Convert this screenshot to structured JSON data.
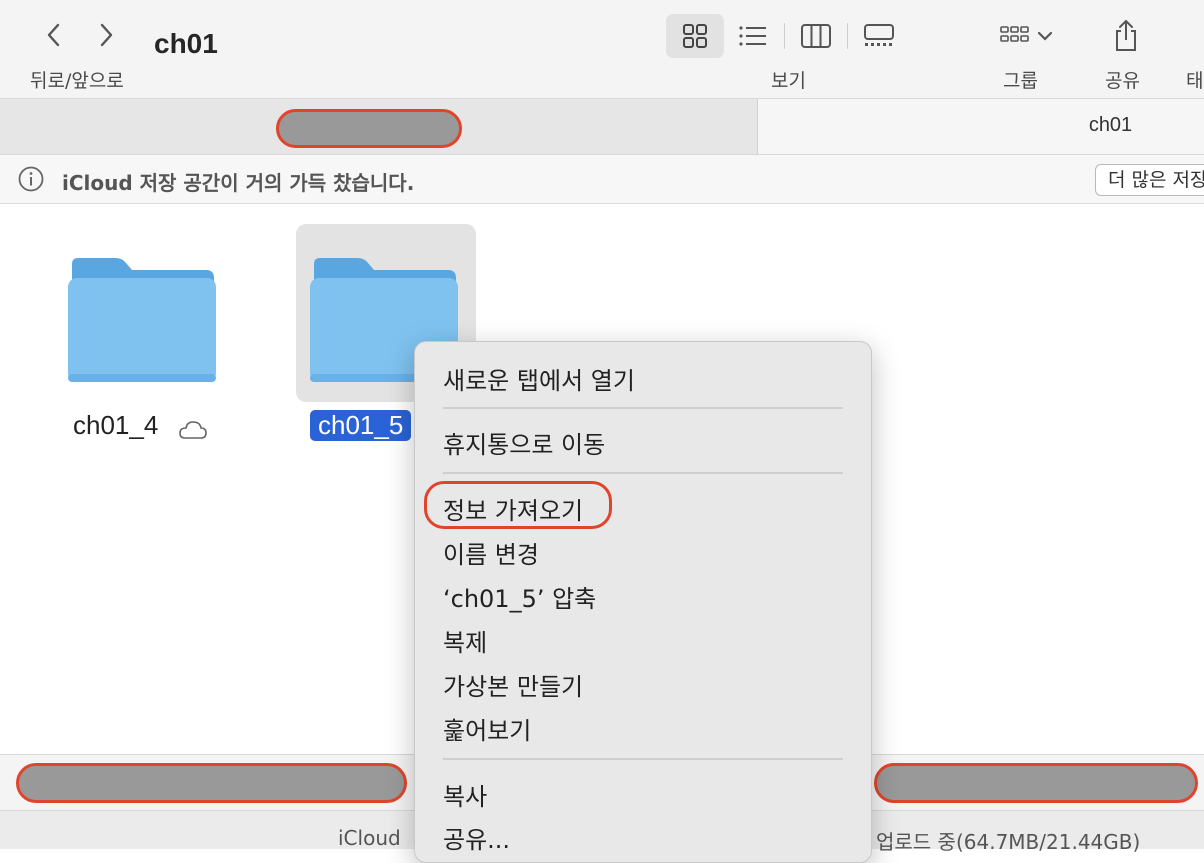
{
  "toolbar": {
    "title": "ch01",
    "nav_label": "뒤로/앞으로",
    "view_label": "보기",
    "group_label": "그룹",
    "share_label": "공유",
    "more_label": "태"
  },
  "tabs": {
    "tab1_label": "",
    "tab2_label": "ch01"
  },
  "banner": {
    "text": "iCloud 저장 공간이 거의 가득 찼습니다.",
    "button": "더 많은 저장"
  },
  "items": [
    {
      "label": "ch01_4",
      "cloud": true,
      "selected": false
    },
    {
      "label": "ch01_5",
      "cloud": false,
      "selected": true
    }
  ],
  "status": {
    "left": "iCloud",
    "right": "업로드 중(64.7MB/21.44GB)"
  },
  "context_menu": {
    "open_new_tab": "새로운 탭에서 열기",
    "move_to_trash": "휴지통으로 이동",
    "get_info": "정보 가져오기",
    "rename": "이름 변경",
    "compress": "‘ch01_5’ 압축",
    "duplicate": "복제",
    "make_alias": "가상본 만들기",
    "quick_look": "훑어보기",
    "copy": "복사",
    "share": "공유..."
  },
  "colors": {
    "selection": "#2a63d6",
    "annotation": "#e0452b",
    "redaction": "#999999",
    "folder_front": "#7fc2f0",
    "folder_back": "#5aa6e0"
  },
  "icons": [
    "chevron-left-icon",
    "chevron-right-icon",
    "grid-view-icon",
    "list-view-icon",
    "column-view-icon",
    "gallery-view-icon",
    "group-icon",
    "share-icon",
    "info-icon",
    "folder-icon",
    "cloud-icon"
  ]
}
